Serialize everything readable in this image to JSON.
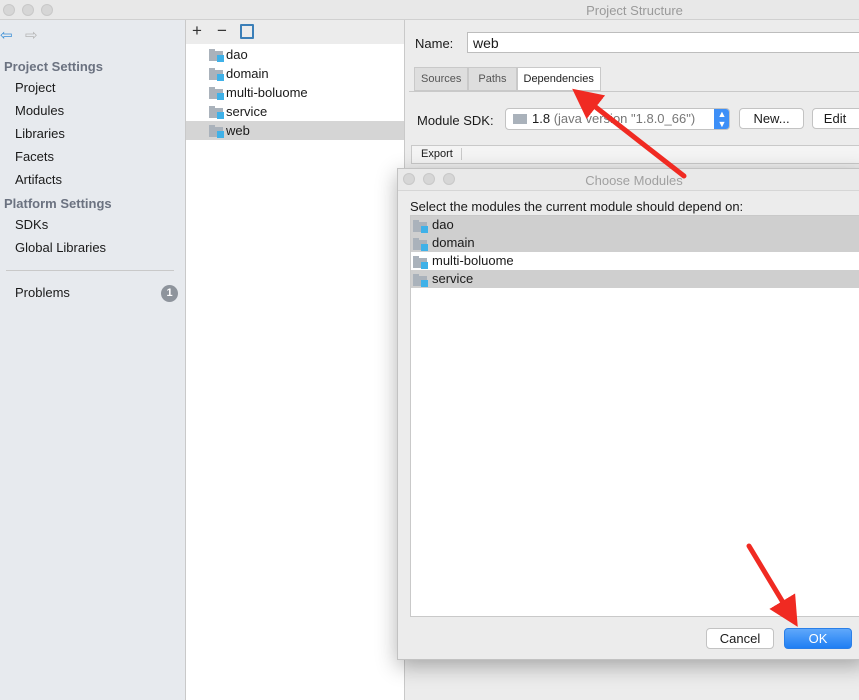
{
  "window": {
    "title": "Project Structure"
  },
  "sidebar": {
    "sections": [
      {
        "title": "Project Settings",
        "items": [
          "Project",
          "Modules",
          "Libraries",
          "Facets",
          "Artifacts"
        ]
      },
      {
        "title": "Platform Settings",
        "items": [
          "SDKs",
          "Global Libraries"
        ]
      }
    ],
    "problems": {
      "label": "Problems",
      "count": "1"
    }
  },
  "modules": {
    "toolbar": {
      "add": "+",
      "remove": "−"
    },
    "items": [
      "dao",
      "domain",
      "multi-boluome",
      "service",
      "web"
    ],
    "selected": "web"
  },
  "detail": {
    "name_label": "Name:",
    "name_value": "web",
    "tabs": [
      "Sources",
      "Paths",
      "Dependencies"
    ],
    "active_tab": "Dependencies",
    "sdk_label": "Module SDK:",
    "sdk_version": "1.8",
    "sdk_detail": "(java version \"1.8.0_66\")",
    "new_button": "New...",
    "edit_button": "Edit",
    "export_header": "Export"
  },
  "dialog": {
    "title": "Choose Modules",
    "prompt": "Select the modules the current module should depend on:",
    "items": [
      {
        "label": "dao",
        "selected": true
      },
      {
        "label": "domain",
        "selected": true
      },
      {
        "label": "multi-boluome",
        "selected": false
      },
      {
        "label": "service",
        "selected": true
      }
    ],
    "cancel": "Cancel",
    "ok": "OK"
  },
  "colors": {
    "accent": "#1f7ef3",
    "annotation": "#f02a22",
    "module_icon": "#3fb1e8"
  }
}
